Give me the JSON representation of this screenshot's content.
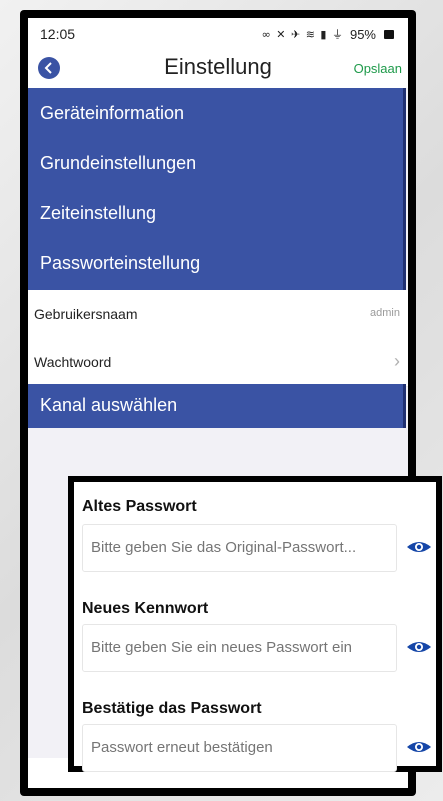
{
  "status_bar": {
    "time": "12:05",
    "icons": "∞ ✕ ✈ ≋ ▮ ⏚",
    "battery": "95%"
  },
  "nav": {
    "title": "Einstellung",
    "save": "Opslaan"
  },
  "menu": {
    "items": [
      {
        "label": "Geräteinformation"
      },
      {
        "label": "Grundeinstellungen"
      },
      {
        "label": "Zeiteinstellung"
      },
      {
        "label": "Passworteinstellung"
      }
    ]
  },
  "account": {
    "username_label": "Gebruikersnaam",
    "username_value": "admin",
    "password_label": "Wachtwoord"
  },
  "channel": {
    "label": "Kanal auswählen"
  },
  "password_form": {
    "old_label": "Altes Passwort",
    "old_placeholder": "Bitte geben Sie das Original-Passwort...",
    "new_label": "Neues Kennwort",
    "new_placeholder": "Bitte geben Sie ein neues Passwort ein",
    "confirm_label": "Bestätige das Passwort",
    "confirm_placeholder": "Passwort erneut bestätigen"
  },
  "colors": {
    "accent_blue": "#3a53a4",
    "save_green": "#1e9a4a"
  }
}
